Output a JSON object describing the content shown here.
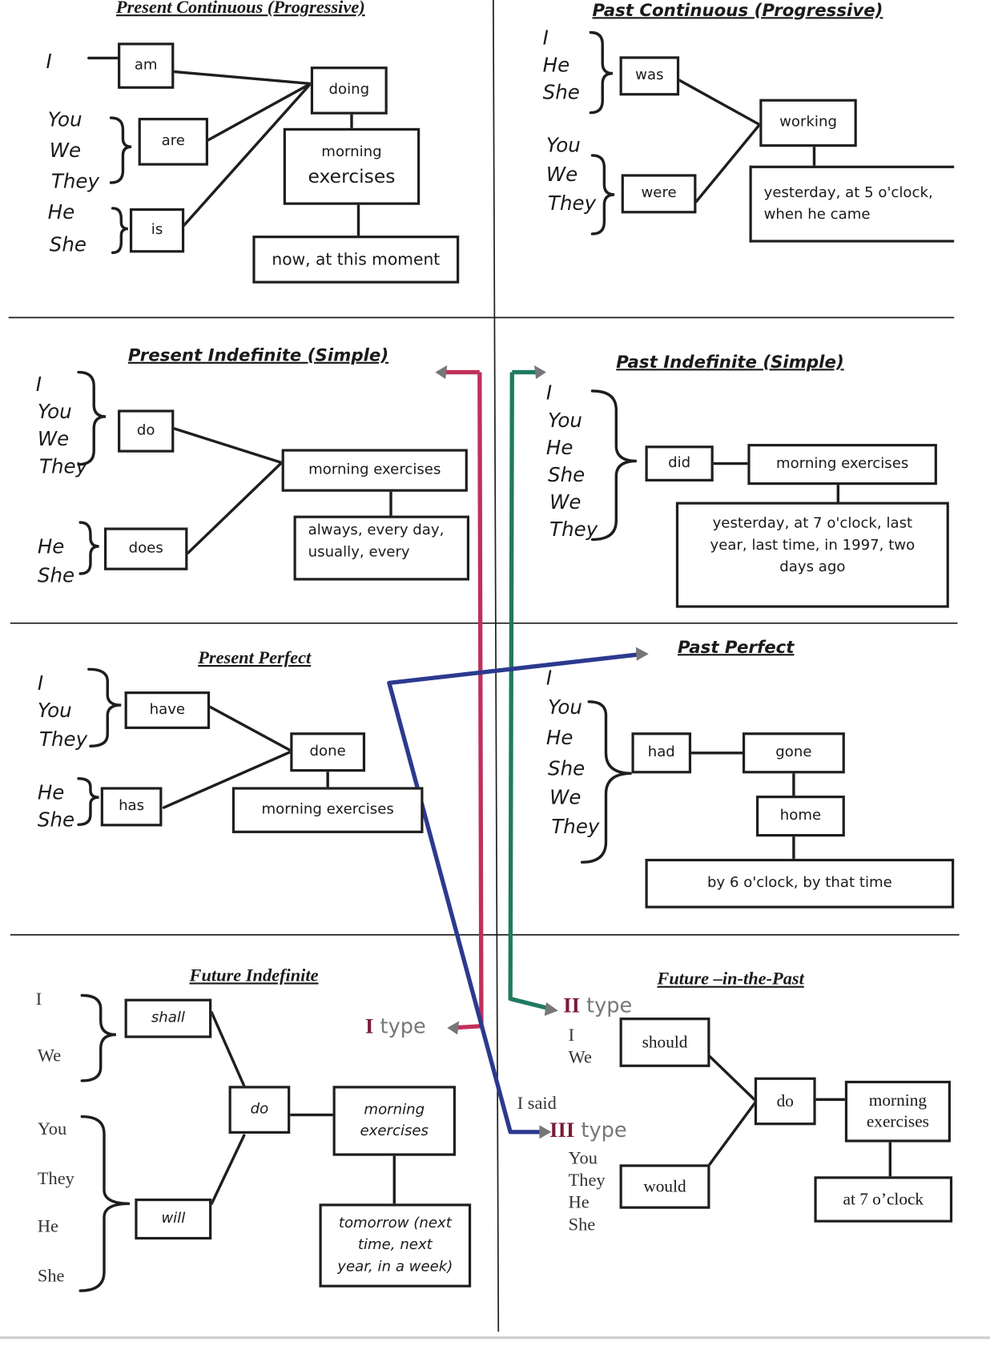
{
  "sections": {
    "present_continuous": {
      "title": "Present Continuous (Progressive)",
      "pronouns": [
        "I",
        "You",
        "We",
        "They",
        "He",
        "She"
      ],
      "aux": [
        "am",
        "are",
        "is"
      ],
      "verb": "doing",
      "object_line1": "morning",
      "object_line2": "exercises",
      "time": "now, at this moment"
    },
    "past_continuous": {
      "title": "Past Continuous (Progressive)",
      "pronouns": [
        "I",
        "He",
        "She",
        "You",
        "We",
        "They"
      ],
      "aux": [
        "was",
        "were"
      ],
      "verb": "working",
      "time_line1": "yesterday, at 5 o'clock,",
      "time_line2": "when he came"
    },
    "present_indefinite": {
      "title": "Present Indefinite (Simple)",
      "pronouns": [
        "I",
        "You",
        "We",
        "They",
        "He",
        "She"
      ],
      "aux": [
        "do",
        "does"
      ],
      "object": "morning exercises",
      "time_line1": "always, every day,",
      "time_line2": "usually, every"
    },
    "past_indefinite": {
      "title": "Past  Indefinite (Simple)",
      "pronouns": [
        "I",
        "You",
        "He",
        "She",
        "We",
        "They"
      ],
      "aux": "did",
      "object": "morning exercises",
      "time_line1": "yesterday, at 7 o'clock, last",
      "time_line2": "year, last time, in 1997, two",
      "time_line3": "days ago"
    },
    "present_perfect": {
      "title": "Present Perfect",
      "pronouns": [
        "I",
        "You",
        "They",
        "He",
        "She"
      ],
      "aux": [
        "have",
        "has"
      ],
      "participle": "done",
      "object": "morning exercises"
    },
    "past_perfect": {
      "title": "Past Perfect",
      "pronouns": [
        "I",
        "You",
        "He",
        "She",
        "We",
        "They"
      ],
      "aux": "had",
      "participle": "gone",
      "object": "home",
      "time": "by 6 o'clock, by that time"
    },
    "future_indefinite": {
      "title": "Future Indefinite",
      "pronouns": [
        "I",
        "We",
        "You",
        "They",
        "He",
        "She"
      ],
      "aux": [
        "shall",
        "will"
      ],
      "verb": "do",
      "object_line1": "morning",
      "object_line2": "exercises",
      "time_line1": "tomorrow (next",
      "time_line2": "time, next",
      "time_line3": "year, in a week)"
    },
    "future_in_the_past": {
      "title": "Future –in-the-Past",
      "pronouns": [
        "I",
        "We",
        "You",
        "They",
        "He",
        "She"
      ],
      "aux": [
        "should",
        "would"
      ],
      "verb": "do",
      "object_line1": "morning",
      "object_line2": "exercises",
      "time": "at 7 o’clock",
      "said_label": "I said"
    }
  },
  "annotations": {
    "type1": {
      "numeral": "I",
      "word": "type"
    },
    "type2": {
      "numeral": "II",
      "word": "type"
    },
    "type3": {
      "numeral": "III",
      "word": "type"
    }
  },
  "colors": {
    "ink": "#1e1e1e",
    "arrow_red": "#c0305a",
    "arrow_green": "#1f7a62",
    "arrow_blue": "#2b3a8f",
    "arrow_head": "#777777",
    "roman_numeral": "#7a1a35"
  }
}
